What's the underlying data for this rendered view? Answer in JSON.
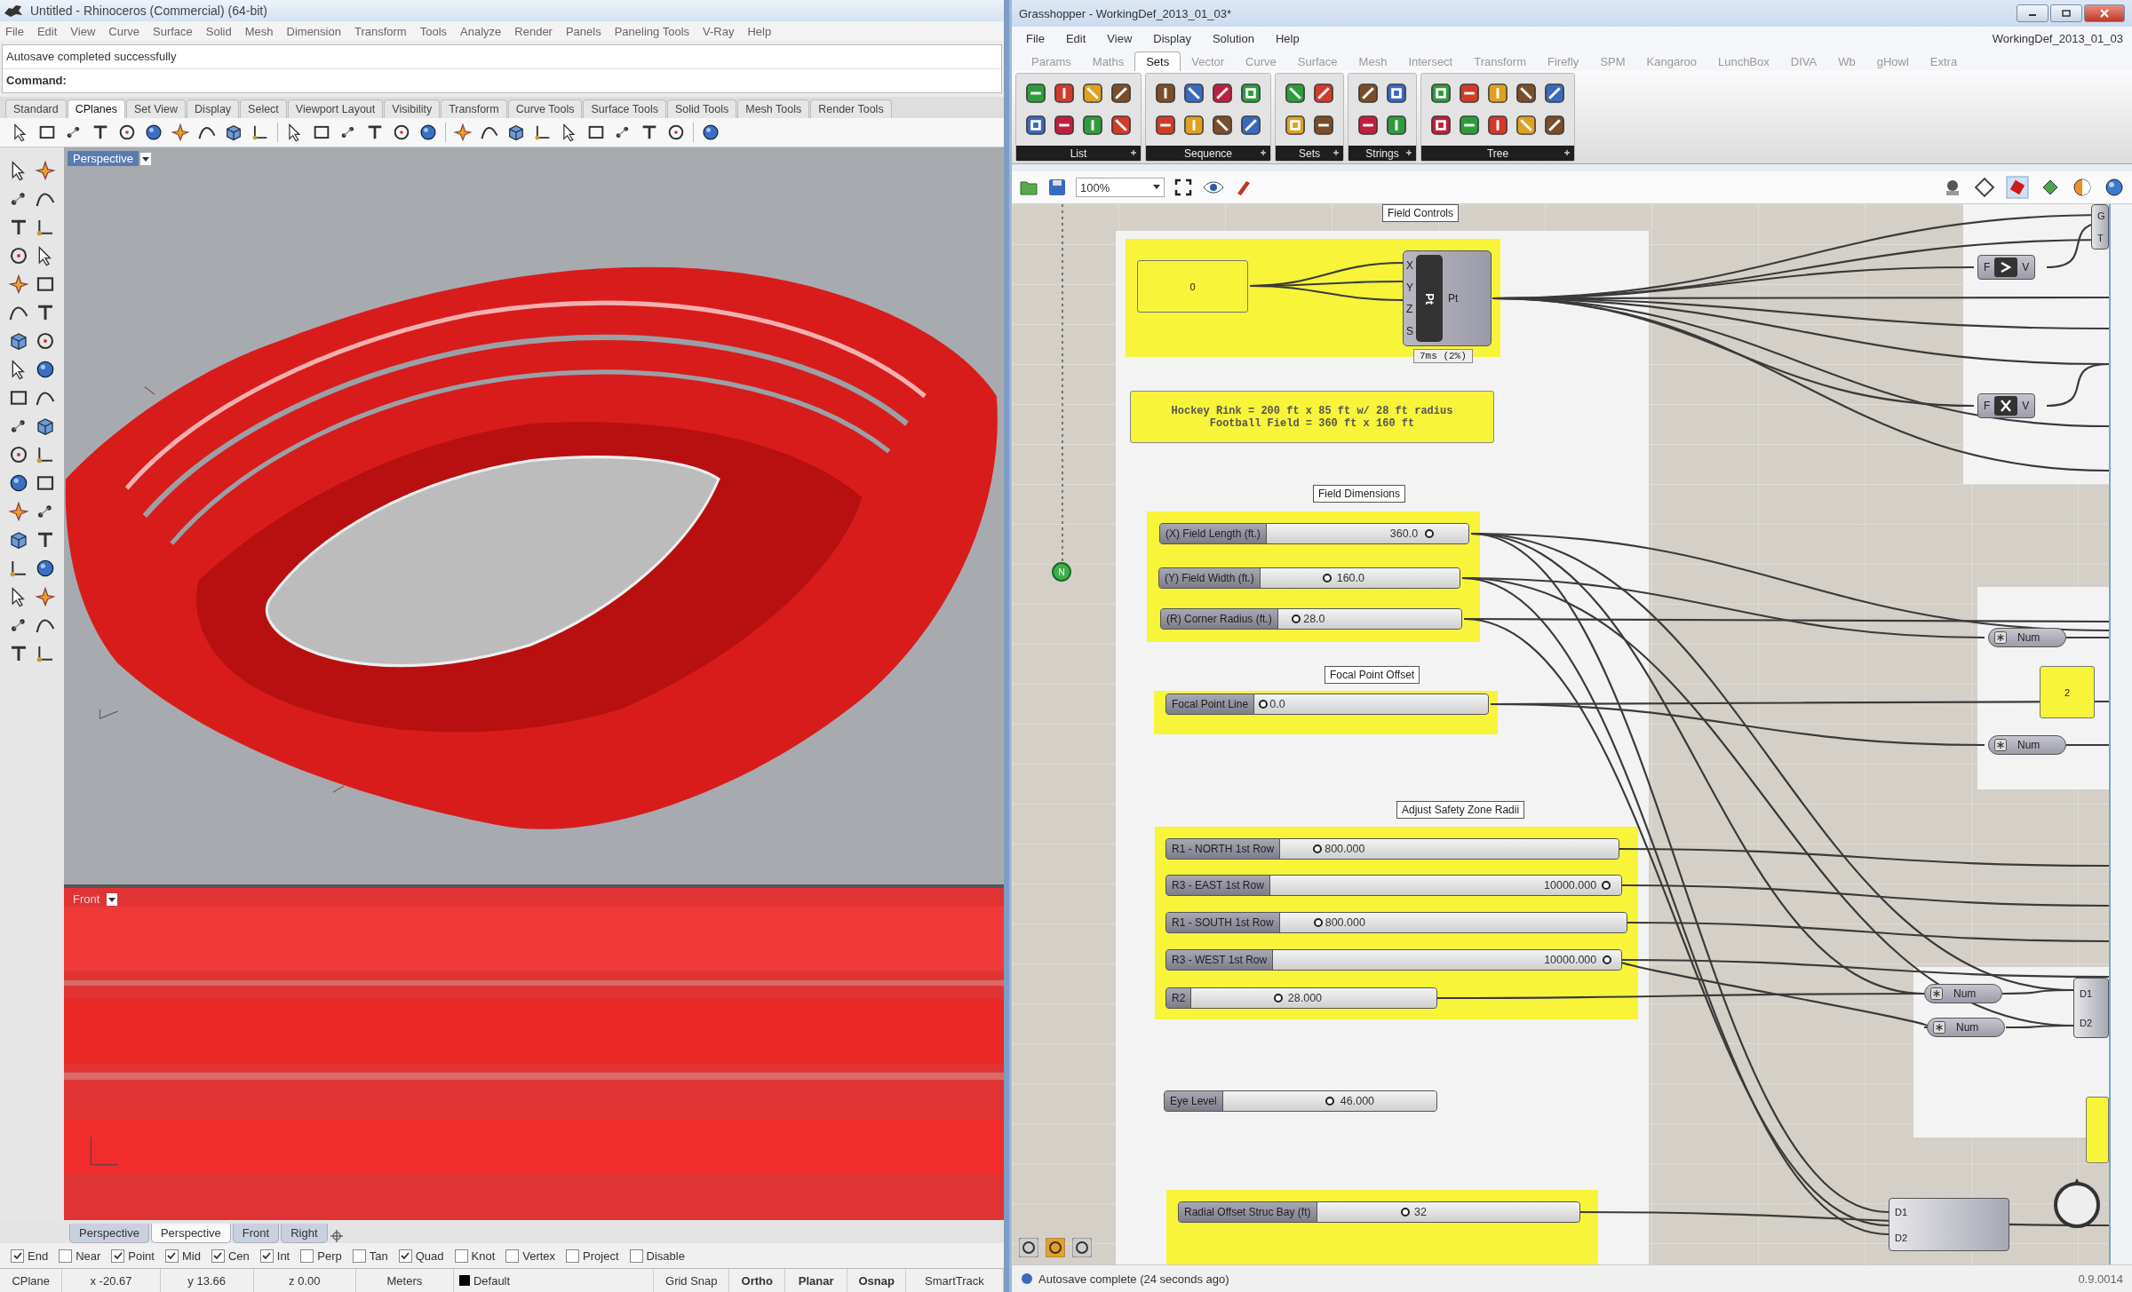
{
  "rhino": {
    "title": "Untitled - Rhinoceros (Commercial) (64-bit)",
    "menu": [
      "File",
      "Edit",
      "View",
      "Curve",
      "Surface",
      "Solid",
      "Mesh",
      "Dimension",
      "Transform",
      "Tools",
      "Analyze",
      "Render",
      "Panels",
      "Paneling Tools",
      "V-Ray",
      "Help"
    ],
    "command_history": "Autosave completed successfully",
    "command_prompt": "Command:",
    "toolbar_tabs": [
      {
        "label": "Standard",
        "selected": false
      },
      {
        "label": "CPlanes",
        "selected": true
      },
      {
        "label": "Set View",
        "selected": false
      },
      {
        "label": "Display",
        "selected": false
      },
      {
        "label": "Select",
        "selected": false
      },
      {
        "label": "Viewport Layout",
        "selected": false
      },
      {
        "label": "Visibility",
        "selected": false
      },
      {
        "label": "Transform",
        "selected": false
      },
      {
        "label": "Curve Tools",
        "selected": false
      },
      {
        "label": "Surface Tools",
        "selected": false
      },
      {
        "label": "Solid Tools",
        "selected": false
      },
      {
        "label": "Mesh Tools",
        "selected": false
      },
      {
        "label": "Render Tools",
        "selected": false
      }
    ],
    "viewports": [
      {
        "title": "Perspective",
        "kind": "perspective"
      },
      {
        "title": "Front",
        "kind": "front"
      }
    ],
    "viewport_tabs": [
      {
        "label": "Perspective",
        "selected": false
      },
      {
        "label": "Perspective",
        "selected": true
      },
      {
        "label": "Front",
        "selected": false
      },
      {
        "label": "Right",
        "selected": false
      }
    ],
    "osnaps": [
      {
        "label": "End",
        "checked": true
      },
      {
        "label": "Near",
        "checked": false
      },
      {
        "label": "Point",
        "checked": true
      },
      {
        "label": "Mid",
        "checked": true
      },
      {
        "label": "Cen",
        "checked": true
      },
      {
        "label": "Int",
        "checked": true
      },
      {
        "label": "Perp",
        "checked": false
      },
      {
        "label": "Tan",
        "checked": false
      },
      {
        "label": "Quad",
        "checked": true
      },
      {
        "label": "Knot",
        "checked": false
      },
      {
        "label": "Vertex",
        "checked": false
      },
      {
        "label": "Project",
        "checked": false
      },
      {
        "label": "Disable",
        "checked": false
      }
    ],
    "status_bar": [
      {
        "text": "CPlane",
        "kind": "cell",
        "bold": false
      },
      {
        "text": "x -20.67",
        "kind": "cell",
        "bold": false
      },
      {
        "text": "y 13.66",
        "kind": "cell",
        "bold": false
      },
      {
        "text": "z 0.00",
        "kind": "cell",
        "bold": false
      },
      {
        "text": "Meters",
        "kind": "cell",
        "bold": false
      },
      {
        "text": "Default",
        "kind": "layer",
        "bold": false
      },
      {
        "text": "Grid Snap",
        "kind": "toggle",
        "bold": false
      },
      {
        "text": "Ortho",
        "kind": "toggle",
        "bold": true
      },
      {
        "text": "Planar",
        "kind": "toggle",
        "bold": true
      },
      {
        "text": "Osnap",
        "kind": "toggle",
        "bold": true
      },
      {
        "text": "SmartTrack",
        "kind": "toggle",
        "bold": false
      }
    ]
  },
  "grasshopper": {
    "title": "Grasshopper - WorkingDef_2013_01_03*",
    "menu": [
      "File",
      "Edit",
      "View",
      "Display",
      "Solution",
      "Help"
    ],
    "document_name": "WorkingDef_2013_01_03",
    "tabs": [
      {
        "label": "Params",
        "selected": false
      },
      {
        "label": "Maths",
        "selected": false
      },
      {
        "label": "Sets",
        "selected": true
      },
      {
        "label": "Vector",
        "selected": false
      },
      {
        "label": "Curve",
        "selected": false
      },
      {
        "label": "Surface",
        "selected": false
      },
      {
        "label": "Mesh",
        "selected": false
      },
      {
        "label": "Intersect",
        "selected": false
      },
      {
        "label": "Transform",
        "selected": false
      },
      {
        "label": "Firefly",
        "selected": false
      },
      {
        "label": "SPM",
        "selected": false
      },
      {
        "label": "Kangaroo",
        "selected": false
      },
      {
        "label": "LunchBox",
        "selected": false
      },
      {
        "label": "DIVA",
        "selected": false
      },
      {
        "label": "Wb",
        "selected": false
      },
      {
        "label": "gHowl",
        "selected": false
      },
      {
        "label": "Extra",
        "selected": false
      }
    ],
    "ribbon_groups": [
      "List",
      "Sequence",
      "Sets",
      "Strings",
      "Tree"
    ],
    "zoom": "100%",
    "canvas": {
      "group_labels": [
        "Field Controls",
        "Field Dimensions",
        "Focal Point Offset",
        "Adjust Safety Zone Radii"
      ],
      "value_panels": [
        "0",
        "2"
      ],
      "note": "Hockey Rink = 200 ft x 85 ft w/ 28 ft radius\nFootball Field = 360 ft x 160 ft",
      "point_component": {
        "inputs": [
          "X",
          "Y",
          "Z",
          "S"
        ],
        "name": "Pt",
        "output": "Pt",
        "timing": "7ms (2%)"
      },
      "relay": "N",
      "sliders": [
        {
          "label": "(X) Field Length (ft.)",
          "value": "360.0",
          "level": 0.82
        },
        {
          "label": "(Y) Field Width (ft.)",
          "value": "160.0",
          "level": 0.33
        },
        {
          "label": "(R) Corner Radius (ft.)",
          "value": "28.0",
          "level": 0.08
        },
        {
          "label": "Focal Point Line",
          "value": "0.0",
          "level": 0.02
        },
        {
          "label": "R1 - NORTH 1st Row",
          "value": "800.000",
          "level": 0.1
        },
        {
          "label": "R3 - EAST 1st Row",
          "value": "10000.000",
          "level": 0.97
        },
        {
          "label": "R1 - SOUTH 1st Row",
          "value": "800.000",
          "level": 0.1
        },
        {
          "label": "R3 - WEST 1st Row",
          "value": "10000.000",
          "level": 0.97
        },
        {
          "label": "R2",
          "value": "28.000",
          "level": 0.35
        },
        {
          "label": "Eye Level",
          "value": "46.000",
          "level": 0.5
        },
        {
          "label": "Radial Offset Struc Bay (ft)",
          "value": "32",
          "level": 0.33
        }
      ],
      "gate_components": [
        {
          "input": "F",
          "output": "V"
        },
        {
          "input": "F",
          "output": "V"
        }
      ],
      "num_params": [
        "Num",
        "Num",
        "Num",
        "Num"
      ],
      "edge_components": [
        {
          "inputs": [
            "G",
            "T"
          ]
        },
        {
          "inputs": [
            "D1",
            "D2"
          ]
        },
        {
          "inputs": [
            "D1",
            "D2"
          ]
        }
      ]
    },
    "status": "Autosave complete (24 seconds ago)",
    "version": "0.9.0014"
  }
}
